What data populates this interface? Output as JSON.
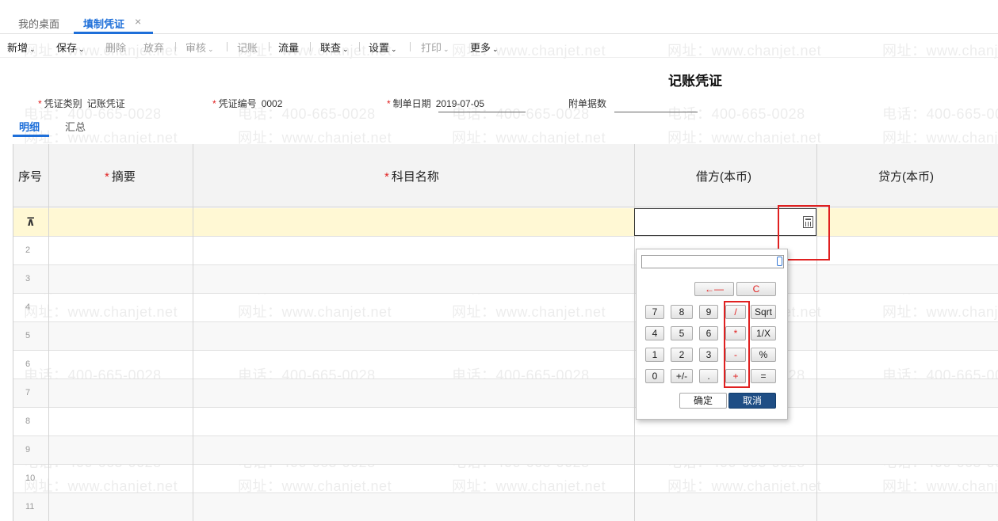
{
  "tabs": [
    {
      "label": "我的桌面"
    },
    {
      "label": "填制凭证",
      "close": "×"
    }
  ],
  "toolbar": {
    "new": "新增",
    "save": "保存",
    "delete": "删除",
    "discard": "放弃",
    "review": "审核",
    "post": "记账",
    "flow": "流量",
    "lookup": "联查",
    "settings": "设置",
    "print": "打印",
    "more": "更多",
    "caret": "⌄"
  },
  "voucher": {
    "title": "记账凭证",
    "type_label": "凭证类别",
    "type_value": "记账凭证",
    "number_label": "凭证编号",
    "number_value": "0002",
    "date_label": "制单日期",
    "date_value": "2019-07-05",
    "attachments_label": "附单据数",
    "attachments_value": ""
  },
  "subtabs": {
    "detail": "明细",
    "summary": "汇总"
  },
  "grid": {
    "headers": {
      "seq": "序号",
      "summary": "摘要",
      "account": "科目名称",
      "debit": "借方(本币)",
      "credit": "贷方(本币)"
    },
    "rows": [
      "2",
      "3",
      "4",
      "5",
      "6",
      "7",
      "8",
      "9",
      "10",
      "11"
    ]
  },
  "watermark": {
    "phone": "电话：400-665-0028",
    "site": "网址：www.chanjet.net"
  },
  "calculator": {
    "display": "",
    "backspace": "←—",
    "clear": "C",
    "keys": [
      "7",
      "8",
      "9",
      "/",
      "Sqrt",
      "4",
      "5",
      "6",
      "*",
      "1/X",
      "1",
      "2",
      "3",
      "-",
      "%",
      "0",
      "+/-",
      ".",
      "+",
      "="
    ],
    "ok": "确定",
    "cancel": "取消"
  },
  "colors": {
    "accent": "#1e6fd9",
    "highlight_row": "#fff8d4",
    "annotation": "#e02020",
    "cancel_button": "#1f4e85"
  }
}
